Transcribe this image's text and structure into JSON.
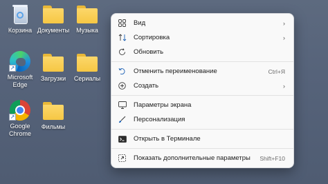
{
  "desktop": {
    "icons": [
      {
        "label": "Корзина",
        "type": "recycle-bin"
      },
      {
        "label": "Документы",
        "type": "folder"
      },
      {
        "label": "Музыка",
        "type": "folder"
      },
      {
        "label": "Microsoft Edge",
        "type": "edge"
      },
      {
        "label": "Загрузки",
        "type": "folder"
      },
      {
        "label": "Сериалы",
        "type": "folder"
      },
      {
        "label": "Google Chrome",
        "type": "chrome"
      },
      {
        "label": "Фильмы",
        "type": "folder"
      }
    ]
  },
  "context_menu": {
    "items": [
      {
        "label": "Вид",
        "icon": "grid-icon",
        "submenu": true
      },
      {
        "label": "Сортировка",
        "icon": "sort-icon",
        "submenu": true
      },
      {
        "label": "Обновить",
        "icon": "refresh-icon"
      },
      {
        "label": "Отменить переименование",
        "icon": "undo-icon",
        "shortcut": "Ctrl+Я"
      },
      {
        "label": "Создать",
        "icon": "new-icon",
        "submenu": true
      },
      {
        "label": "Параметры экрана",
        "icon": "display-icon"
      },
      {
        "label": "Персонализация",
        "icon": "brush-icon"
      },
      {
        "label": "Открыть в Терминале",
        "icon": "terminal-icon"
      },
      {
        "label": "Показать дополнительные параметры",
        "icon": "more-options-icon",
        "shortcut": "Shift+F10"
      }
    ],
    "submenu_glyph": "›"
  },
  "colors": {
    "wallpaper": "#56637a",
    "menu_background": "#f9f9f9",
    "folder": "#f6c744",
    "accent": "#1a5fb4"
  }
}
